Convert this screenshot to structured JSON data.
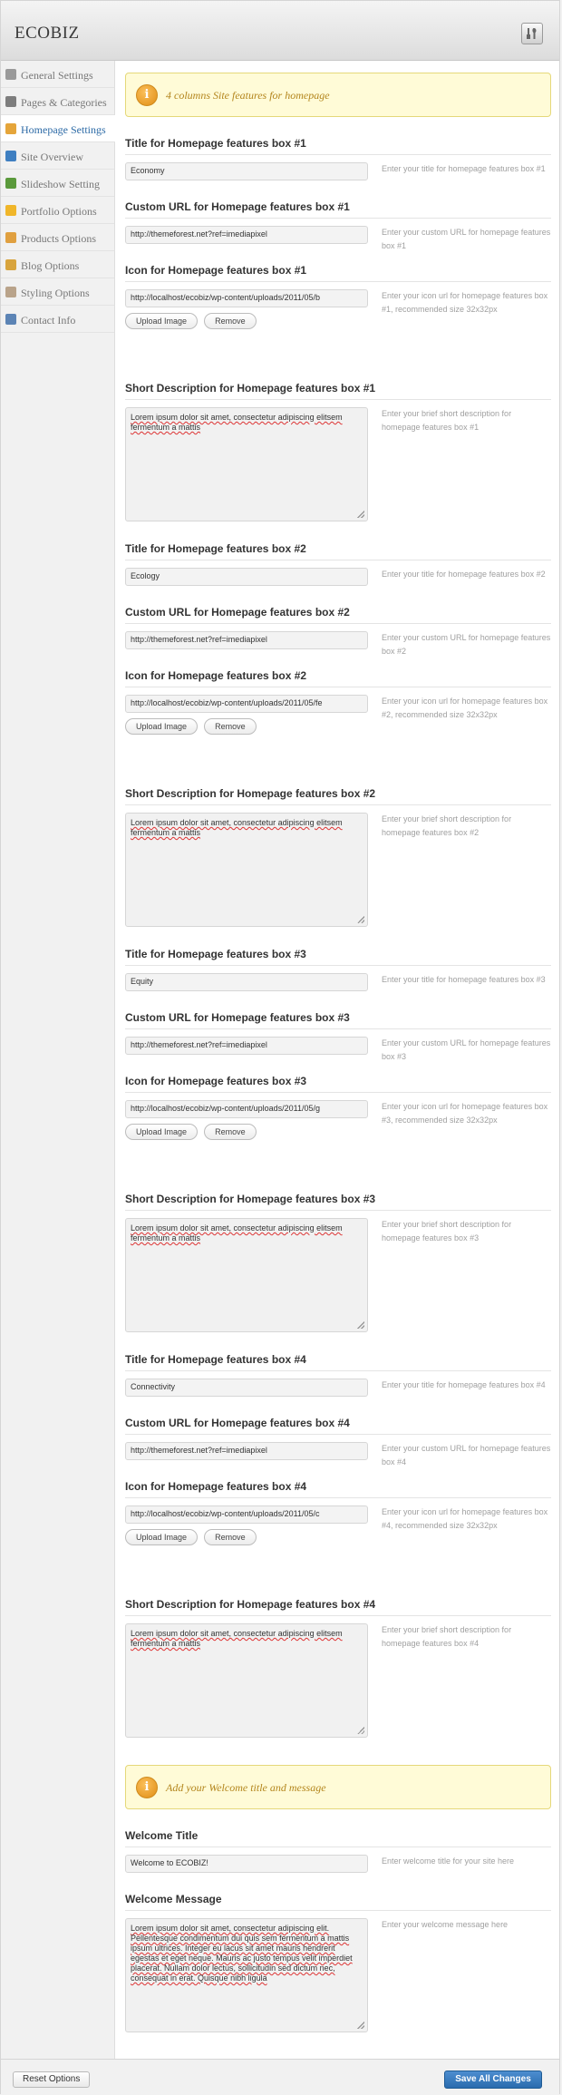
{
  "header": {
    "brand": "ECOBIZ"
  },
  "sidebar": {
    "items": [
      {
        "label": "General Settings",
        "icon": "gear-icon",
        "color": "#9a9a9a"
      },
      {
        "label": "Pages & Categories",
        "icon": "pages-icon",
        "color": "#7d7d7d"
      },
      {
        "label": "Homepage Settings",
        "icon": "home-icon",
        "color": "#e5a53a"
      },
      {
        "label": "Site Overview",
        "icon": "monitor-icon",
        "color": "#3f7fc1"
      },
      {
        "label": "Slideshow Setting",
        "icon": "slideshow-icon",
        "color": "#5b9a3c"
      },
      {
        "label": "Portfolio Options",
        "icon": "star-icon",
        "color": "#f0b62a"
      },
      {
        "label": "Products Options",
        "icon": "box-icon",
        "color": "#e0a040"
      },
      {
        "label": "Blog Options",
        "icon": "pencil-icon",
        "color": "#d8a43d"
      },
      {
        "label": "Styling Options",
        "icon": "palette-icon",
        "color": "#b9a38a"
      },
      {
        "label": "Contact Info",
        "icon": "contact-icon",
        "color": "#5c84b5"
      }
    ]
  },
  "notices": [
    {
      "text": "4 columns Site features for homepage"
    },
    {
      "text": "Add your Welcome title and message"
    }
  ],
  "ui": {
    "upload_label": "Upload Image",
    "remove_label": "Remove"
  },
  "boxes": [
    {
      "title_label": "Title for Homepage features box #1",
      "title_value": "Economy",
      "title_desc": "Enter your title for homepage features box #1",
      "url_label": "Custom URL for Homepage features box #1",
      "url_value": "http://themeforest.net?ref=imediapixel",
      "url_desc": "Enter your custom URL for homepage features box #1",
      "icon_label": "Icon for Homepage features box #1",
      "icon_value": "http://localhost/ecobiz/wp-content/uploads/2011/05/b",
      "icon_desc": "Enter your icon url for homepage features box #1, recommended size 32x32px",
      "short_label": "Short Description for Homepage features box #1",
      "short_value": "Lorem ipsum dolor sit amet, consectetur adipiscing elitsem fermentum a mattis",
      "short_desc": "Enter your brief short description for homepage features box #1"
    },
    {
      "title_label": "Title for Homepage features box #2",
      "title_value": "Ecology",
      "title_desc": "Enter your title for homepage features box #2",
      "url_label": "Custom URL for Homepage features box #2",
      "url_value": "http://themeforest.net?ref=imediapixel",
      "url_desc": "Enter your custom URL for homepage features box #2",
      "icon_label": "Icon for Homepage features box #2",
      "icon_value": "http://localhost/ecobiz/wp-content/uploads/2011/05/fe",
      "icon_desc": "Enter your icon url for homepage features box #2, recommended size 32x32px",
      "short_label": "Short Description for Homepage features box #2",
      "short_value": "Lorem ipsum dolor sit amet, consectetur adipiscing elitsem fermentum a mattis",
      "short_desc": "Enter your brief short description for homepage features box #2"
    },
    {
      "title_label": "Title for Homepage features box #3",
      "title_value": "Equity",
      "title_desc": "Enter your title for homepage features box #3",
      "url_label": "Custom URL for Homepage features box #3",
      "url_value": "http://themeforest.net?ref=imediapixel",
      "url_desc": "Enter your custom URL for homepage features box #3",
      "icon_label": "Icon for Homepage features box #3",
      "icon_value": "http://localhost/ecobiz/wp-content/uploads/2011/05/g",
      "icon_desc": "Enter your icon url for homepage features box #3, recommended size 32x32px",
      "short_label": "Short Description for Homepage features box #3",
      "short_value": "Lorem ipsum dolor sit amet, consectetur adipiscing elitsem fermentum a mattis",
      "short_desc": "Enter your brief short description for homepage features box #3"
    },
    {
      "title_label": "Title for Homepage features box #4",
      "title_value": "Connectivity",
      "title_desc": "Enter your title for homepage features box #4",
      "url_label": "Custom URL for Homepage features box #4",
      "url_value": "http://themeforest.net?ref=imediapixel",
      "url_desc": "Enter your custom URL for homepage features box #4",
      "icon_label": "Icon for Homepage features box #4",
      "icon_value": "http://localhost/ecobiz/wp-content/uploads/2011/05/c",
      "icon_desc": "Enter your icon url for homepage features box #4, recommended size 32x32px",
      "short_label": "Short Description for Homepage features box #4",
      "short_value": "Lorem ipsum dolor sit amet, consectetur adipiscing elitsem fermentum a mattis",
      "short_desc": "Enter your brief short description for homepage features box #4"
    }
  ],
  "welcome": {
    "title_label": "Welcome Title",
    "title_value": "Welcome to ECOBIZ!",
    "title_desc": "Enter welcome title for your site here",
    "message_label": "Welcome Message",
    "message_value": "Lorem ipsum dolor sit amet, consectetur adipiscing elit. Pellentesque condimentum dui quis sem fermentum a mattis ipsum ultrices. Integer eu lacus sit amet mauris hendrerit egestas et eget neque. Mauris ac justo tempus velit imperdiet placerat. Nullam dolor lectus, sollicitudin sed dictum nec, consequat in erat. Quisque nibh ligula",
    "message_desc": "Enter your welcome message here"
  },
  "footer": {
    "reset_label": "Reset Options",
    "save_label": "Save All Changes"
  }
}
